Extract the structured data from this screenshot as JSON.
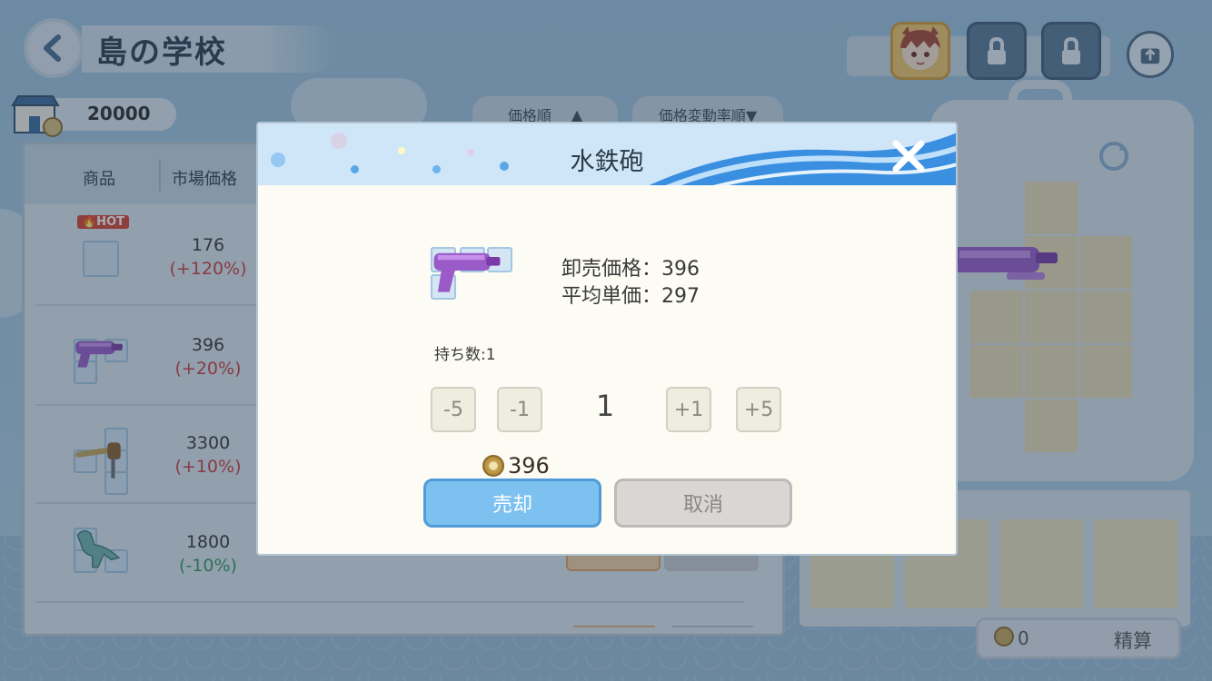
{
  "header": {
    "title": "島の学校",
    "money": "20000"
  },
  "sort": {
    "price_label": "価格順",
    "price_arrow": "▲",
    "change_label": "価格変動率順▼"
  },
  "table": {
    "columns": [
      "商品",
      "市場価格"
    ],
    "hot_badge": "🔥HOT",
    "rows": [
      {
        "item": "shell",
        "price": "176",
        "change": "(+120%)",
        "direction": "up"
      },
      {
        "item": "water-gun",
        "price": "396",
        "change": "(+20%)",
        "direction": "up"
      },
      {
        "item": "telescope",
        "price": "3300",
        "change": "(+10%)",
        "direction": "up"
      },
      {
        "item": "dinosaur",
        "price": "1800",
        "change": "(-10%)",
        "direction": "down"
      }
    ]
  },
  "bag": {
    "settle_count": "0",
    "settle_label": "精算"
  },
  "modal": {
    "title": "水鉄砲",
    "wholesale": "卸売価格：396",
    "average": "平均単価：297",
    "owned": "持ち数:1",
    "steps": [
      "-5",
      "-1",
      "+1",
      "+5"
    ],
    "quantity": "1",
    "total": "396",
    "sell_label": "売却",
    "cancel_label": "取消"
  },
  "colors": {
    "accent": "#7cc1f0",
    "up": "#cf3b3b",
    "down": "#2f9a5a",
    "water_gun": "#9a5bc9"
  },
  "icons": [
    "back-icon",
    "shop-icon",
    "coin-icon",
    "close-icon",
    "refresh-icon",
    "lock-icon",
    "upload-icon",
    "water-gun-icon",
    "shell-icon"
  ]
}
